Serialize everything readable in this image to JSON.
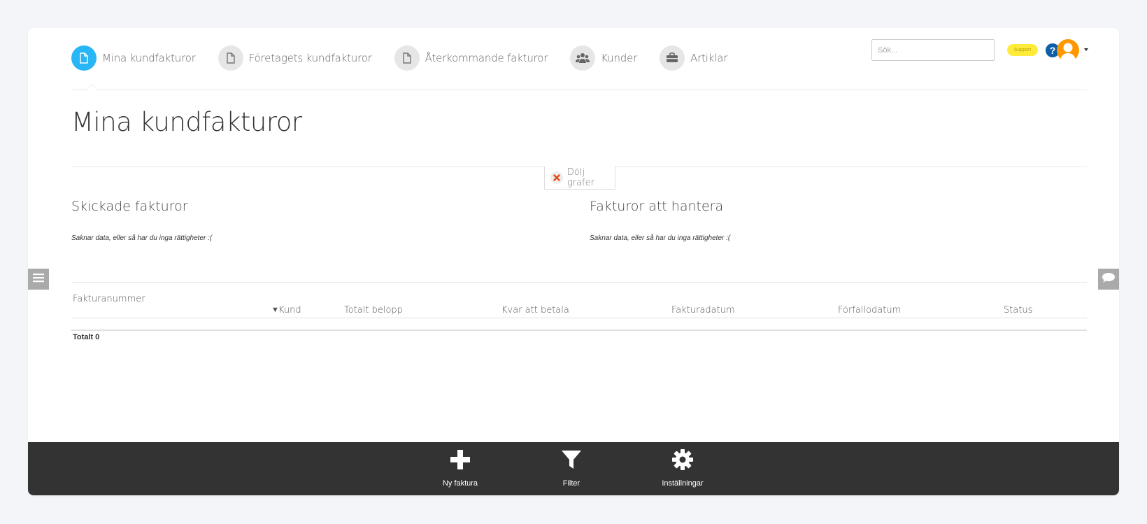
{
  "nav": {
    "items": [
      {
        "label": "Mina kundfakturor",
        "icon": "document-icon",
        "active": true
      },
      {
        "label": "Företagets kundfakturor",
        "icon": "document-icon",
        "active": false
      },
      {
        "label": "Återkommande fakturor",
        "icon": "document-icon",
        "active": false
      },
      {
        "label": "Kunder",
        "icon": "users-icon",
        "active": false
      },
      {
        "label": "Artiklar",
        "icon": "briefcase-icon",
        "active": false
      }
    ]
  },
  "header": {
    "search_placeholder": "Sök...",
    "support_label": "Support",
    "help_glyph": "?"
  },
  "page": {
    "title": "Mina kundfakturor",
    "hide_charts_label": "Dölj grafer"
  },
  "charts": {
    "sent": {
      "title": "Skickade fakturor",
      "empty": "Saknar data, eller så har du inga rättigheter :("
    },
    "handle": {
      "title": "Fakturor att hantera",
      "empty": "Saknar data, eller så har du inga rättigheter :("
    }
  },
  "table": {
    "columns": {
      "number": "Fakturanummer",
      "customer": "Kund",
      "sort_glyph": "▼",
      "total": "Totalt belopp",
      "remaining": "Kvar att betala",
      "date": "Fakturadatum",
      "due": "Förfallodatum",
      "status": "Status"
    },
    "total_label": "Totalt 0"
  },
  "footer": {
    "new_invoice": "Ny faktura",
    "filter": "Filter",
    "settings": "Inställningar"
  },
  "colors": {
    "accent": "#29b6f6",
    "footer_bg": "#333333",
    "support_bg": "#ffeb3b",
    "help_bg": "#0d5ea8",
    "avatar_bg": "#ff9800"
  }
}
